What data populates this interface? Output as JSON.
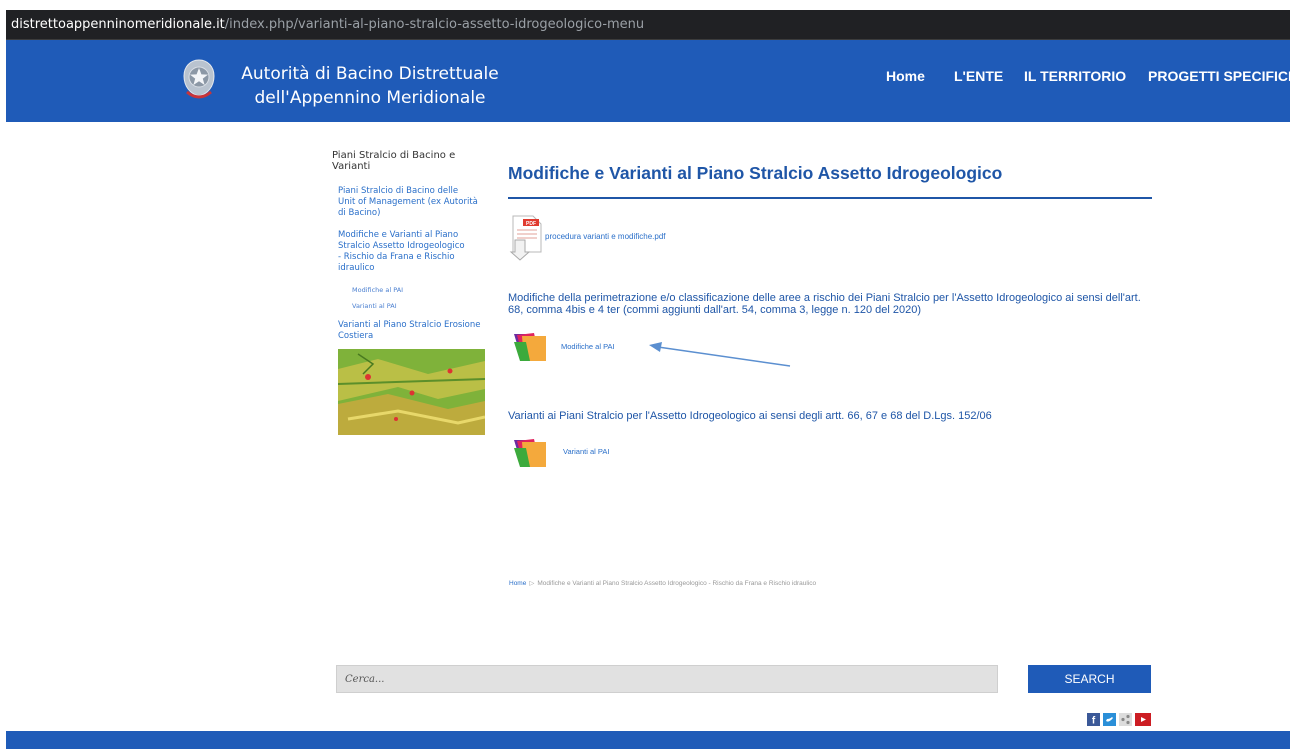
{
  "browser": {
    "url_domain": "distrettoappenninomeridionale.it",
    "url_path": "/index.php/varianti-al-piano-stralcio-assetto-idrogeologico-menu"
  },
  "header": {
    "title_line1": "Autorità di Bacino Distrettuale",
    "title_line2": "dell'Appennino Meridionale",
    "nav": [
      "Home",
      "L'ENTE",
      "IL TERRITORIO",
      "PROGETTI SPECIFICI"
    ]
  },
  "sidebar": {
    "heading": "Piani Stralcio di Bacino e Varianti",
    "links": [
      "Piani Stralcio di Bacino delle Unit of Management (ex Autorità di Bacino)",
      "Modifiche e Varianti al Piano Stralcio Assetto Idrogeologico - Rischio da Frana e Rischio idraulico",
      "Varianti al Piano Stralcio Erosione Costiera"
    ],
    "sublinks": [
      "Modifiche al PAI",
      "Varianti al PAI"
    ]
  },
  "main": {
    "title": "Modifiche e Varianti al Piano Stralcio Assetto Idrogeologico",
    "pdf_link": "procedura varianti e modifiche.pdf",
    "section1_text": "Modifiche della perimetrazione e/o classificazione delle aree a rischio dei Piani Stralcio per l'Assetto Idrogeologico ai sensi dell'art. 68, comma 4bis e 4 ter (commi aggiunti dall'art. 54, comma 3, legge n. 120 del 2020)",
    "section1_link": "Modifiche al PAI",
    "section2_text": "Varianti ai Piani Stralcio per l'Assetto Idrogeologico ai sensi degli artt. 66, 67 e 68 del D.Lgs. 152/06",
    "section2_link": "Varianti al PAI"
  },
  "breadcrumb": {
    "home": "Home",
    "current": "Modifiche e Varianti al Piano Stralcio Assetto Idrogeologico - Rischio da Frana e Rischio idraulico"
  },
  "search": {
    "placeholder": "Cerca...",
    "button": "SEARCH"
  },
  "social_icons": [
    "facebook-icon",
    "twitter-icon",
    "share-icon",
    "youtube-icon"
  ],
  "colors": {
    "brand_blue": "#1f5bb8",
    "link_blue": "#2a6fc9"
  }
}
